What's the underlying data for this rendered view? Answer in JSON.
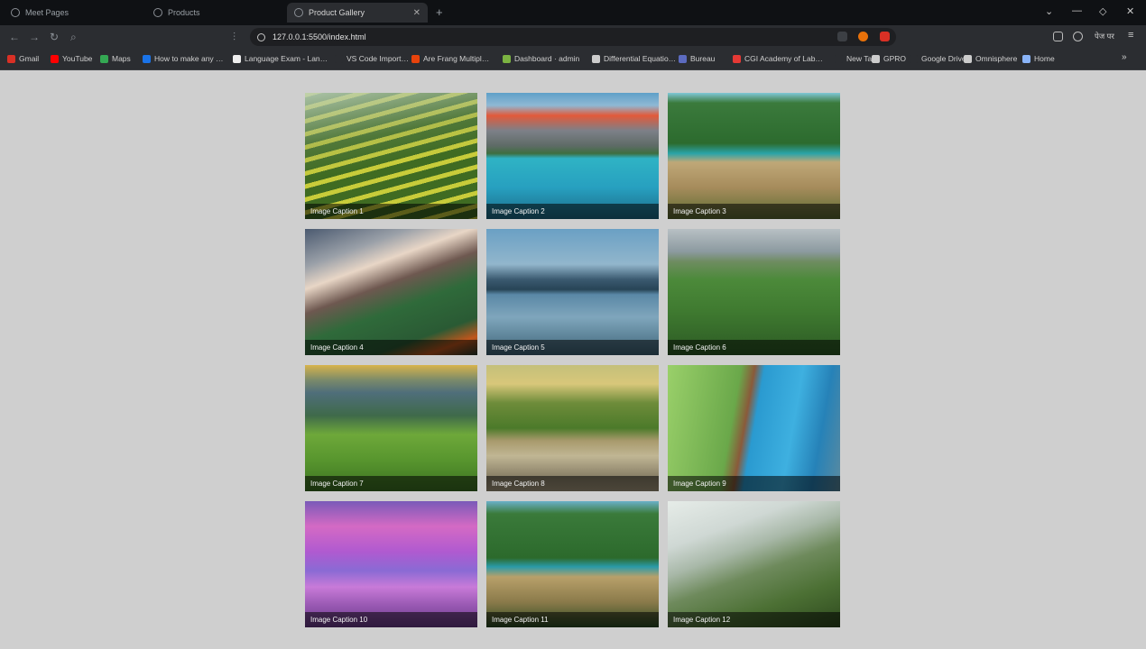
{
  "browser": {
    "tabs": [
      {
        "label": "Meet Pages"
      },
      {
        "label": "Products"
      },
      {
        "label": "Product Gallery"
      }
    ],
    "address": "127.0.0.1:5500/index.html",
    "profile_label": "पेज पर",
    "bookmarks": [
      {
        "label": "Gmail",
        "color": "#d93025"
      },
      {
        "label": "YouTube",
        "color": "#ff0000"
      },
      {
        "label": "Maps",
        "color": "#34a853"
      },
      {
        "label": "How to make any …",
        "color": "#1a73e8"
      },
      {
        "label": "Language Exam - Lan…",
        "color": "#eeeeee"
      },
      {
        "label": "VS Code Import…",
        "color": "#2b2d31"
      },
      {
        "label": "Are Frang Multipl…",
        "color": "#e8430c"
      },
      {
        "label": "Dashboard · admin",
        "color": "#7cb342"
      },
      {
        "label": "Differential Equatio…",
        "color": "#cccccc"
      },
      {
        "label": "Bureau",
        "color": "#5c6bc0"
      },
      {
        "label": "CGI Academy of Lab…",
        "color": "#e53935"
      },
      {
        "label": "New Tab",
        "color": "#2b2d31"
      },
      {
        "label": "GPRO",
        "color": "#cccccc"
      },
      {
        "label": "Google Drive",
        "color": "#2b2d31"
      },
      {
        "label": "Omnisphere",
        "color": "#cccccc"
      },
      {
        "label": "Home",
        "color": "#8ab4f8"
      }
    ]
  },
  "gallery": {
    "images": [
      {
        "caption": "Image Caption 1",
        "theme": "rice-terraces"
      },
      {
        "caption": "Image Caption 2",
        "theme": "mountain-lake"
      },
      {
        "caption": "Image Caption 3",
        "theme": "train-bridge"
      },
      {
        "caption": "Image Caption 4",
        "theme": "alpine-cabin"
      },
      {
        "caption": "Image Caption 5",
        "theme": "misty-lake"
      },
      {
        "caption": "Image Caption 6",
        "theme": "green-hills"
      },
      {
        "caption": "Image Caption 7",
        "theme": "tea-hills"
      },
      {
        "caption": "Image Caption 8",
        "theme": "elephants"
      },
      {
        "caption": "Image Caption 9",
        "theme": "blue-train"
      },
      {
        "caption": "Image Caption 10",
        "theme": "sunset-beach"
      },
      {
        "caption": "Image Caption 11",
        "theme": "jungle-bridge"
      },
      {
        "caption": "Image Caption 12",
        "theme": "misty-mountain"
      }
    ]
  }
}
